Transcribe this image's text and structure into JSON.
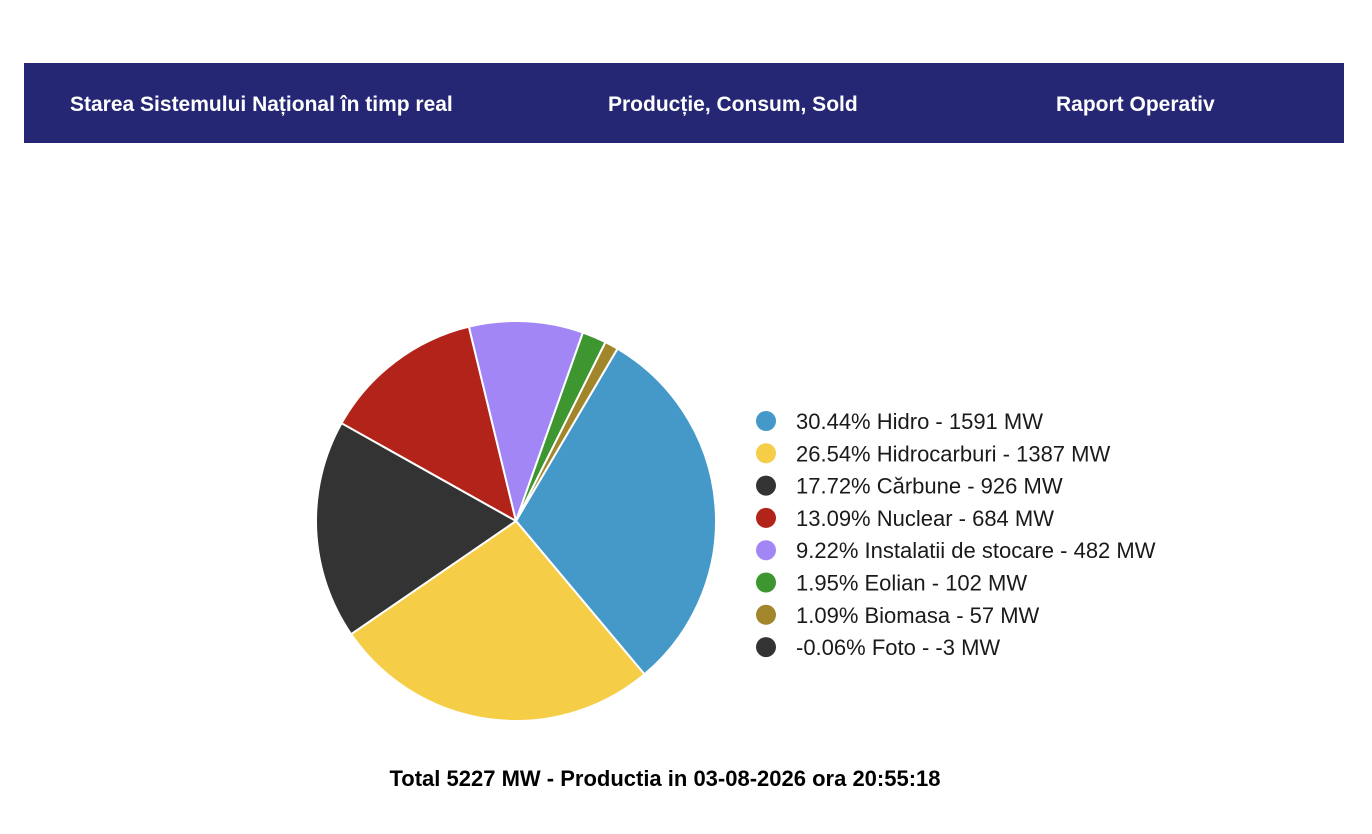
{
  "nav": {
    "tabs": [
      {
        "label": "Starea Sistemului Național în timp real"
      },
      {
        "label": "Producție, Consum, Sold"
      },
      {
        "label": "Raport Operativ"
      }
    ],
    "background": "#252775"
  },
  "chart_data": {
    "type": "pie",
    "unit": "MW",
    "legend_position": "right",
    "slices": [
      {
        "name": "Hidro",
        "percent": 30.44,
        "value": 1591,
        "color": "#4599c8",
        "label": "30.44% Hidro - 1591 MW"
      },
      {
        "name": "Hidrocarburi",
        "percent": 26.54,
        "value": 1387,
        "color": "#f6cd47",
        "label": "26.54% Hidrocarburi - 1387 MW"
      },
      {
        "name": "Cărbune",
        "percent": 17.72,
        "value": 926,
        "color": "#333333",
        "label": "17.72% Cărbune - 926 MW"
      },
      {
        "name": "Nuclear",
        "percent": 13.09,
        "value": 684,
        "color": "#b2231a",
        "label": "13.09% Nuclear - 684 MW"
      },
      {
        "name": "Instalatii de stocare",
        "percent": 9.22,
        "value": 482,
        "color": "#a386f5",
        "label": "9.22% Instalatii de stocare - 482 MW"
      },
      {
        "name": "Eolian",
        "percent": 1.95,
        "value": 102,
        "color": "#3d9630",
        "label": "1.95% Eolian - 102 MW"
      },
      {
        "name": "Biomasa",
        "percent": 1.09,
        "value": 57,
        "color": "#a2862c",
        "label": "1.09% Biomasa - 57 MW"
      },
      {
        "name": "Foto",
        "percent": -0.06,
        "value": -3,
        "color": "#333333",
        "label": "-0.06% Foto - -3 MW"
      }
    ]
  },
  "caption": "Total 5227 MW - Productia in 03-08-2026 ora 20:55:18"
}
